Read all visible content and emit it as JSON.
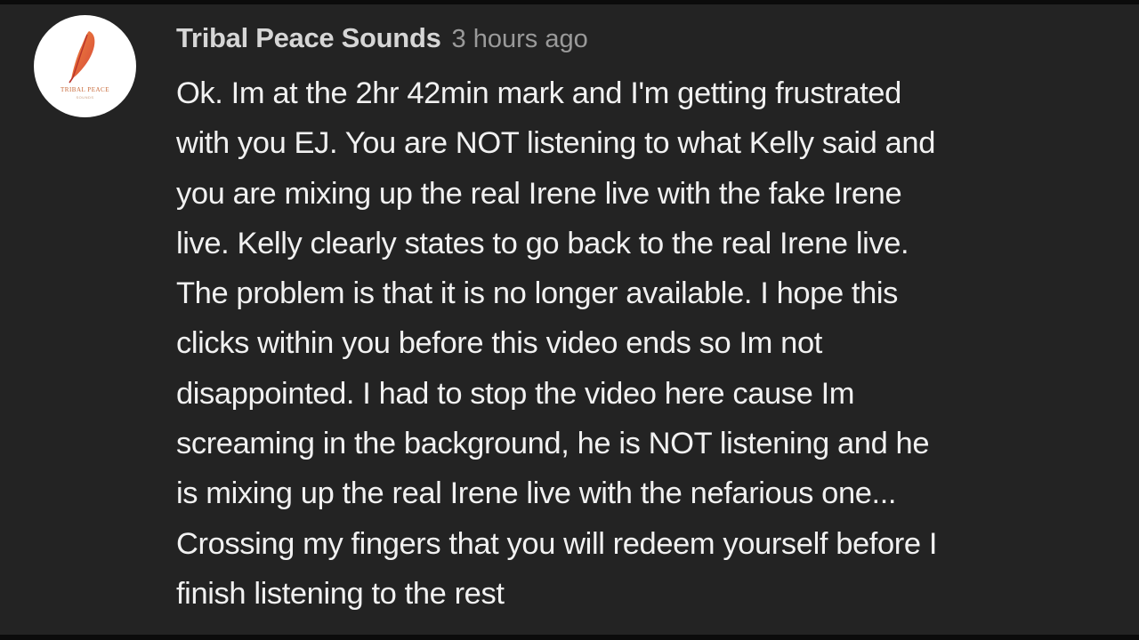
{
  "comment": {
    "author": "Tribal Peace Sounds",
    "timestamp": "3 hours ago",
    "avatar_icon": "feather-logo-icon",
    "avatar_text": "TRIBAL PEACE",
    "avatar_subtext": "SOUNDS",
    "lines": [
      "Ok. Im at the 2hr 42min mark and I'm getting frustrated",
      "with you EJ. You are NOT listening to what Kelly said and",
      "you are mixing up the real Irene live with the fake Irene",
      "live. Kelly clearly states to go back to the real Irene live.",
      "The problem is that it is no longer available. I hope this",
      "clicks within you before this video ends so Im not",
      "disappointed. I had to stop the video here cause Im",
      "screaming in the background, he is NOT listening and he",
      "is mixing up the real Irene live with the nefarious one...",
      "Crossing my fingers that you will redeem yourself before I",
      "finish listening to the rest"
    ]
  },
  "colors": {
    "background": "#232323",
    "author": "#d6d6d6",
    "timestamp": "#9a9a9a",
    "text": "#f1f1f1",
    "feather_red": "#d6453a",
    "feather_orange": "#f08a3c"
  }
}
